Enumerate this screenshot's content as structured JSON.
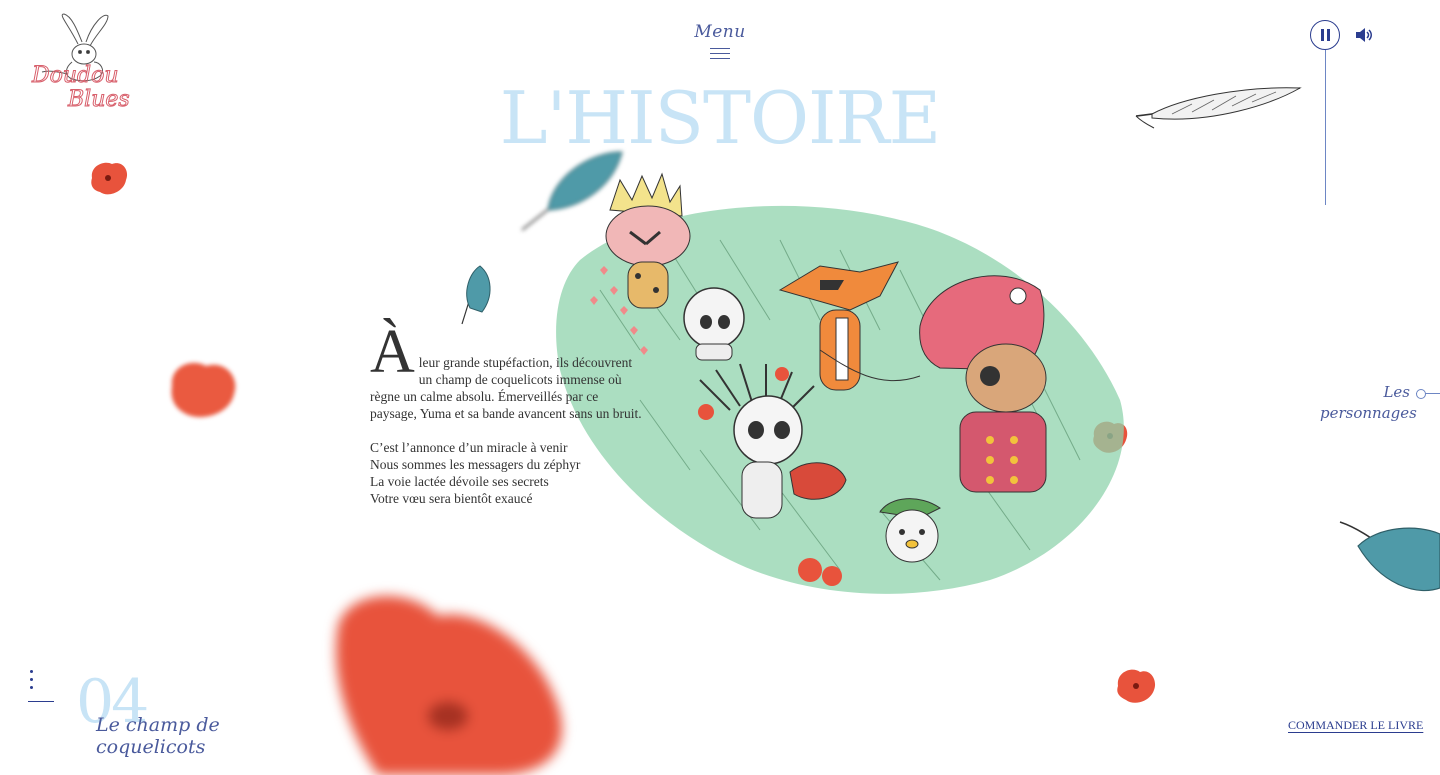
{
  "brand": {
    "logo_text_line1": "Doudou",
    "logo_text_line2": "Blues"
  },
  "header": {
    "menu_label": "Menu"
  },
  "page": {
    "title": "L'HISTOIRE"
  },
  "story": {
    "dropcap": "À",
    "paragraph": "leur grande stupéfaction, ils découvrent un champ de coquelicots immense où règne un calme absolu. Émerveillés par ce paysage, Yuma et sa bande avancent sans un bruit.",
    "poem": [
      "C’est l’annonce d’un miracle à venir",
      "Nous sommes les messagers du zéphyr",
      "La voie lactée dévoile ses secrets",
      "Votre vœu sera bientôt exaucé"
    ]
  },
  "side_nav": {
    "line1": "Les",
    "line2": "personnages"
  },
  "chapter": {
    "number": "04",
    "title_line1": "Le champ de",
    "title_line2": "coquelicots"
  },
  "footer": {
    "order_label": "COMMANDER LE LIVRE"
  },
  "icons": {
    "pause": "pause-icon",
    "volume": "volume-icon",
    "menu": "hamburger-icon",
    "chapter_nav": "vertical-dots-icon"
  },
  "colors": {
    "accent_blue": "#2b3d8f",
    "title_blue": "#c8e4f6",
    "script_blue": "#4a5a9c",
    "poppy_red": "#e8533c",
    "feather_teal": "#4f9aa8",
    "grass_green": "#8fd3ac"
  }
}
